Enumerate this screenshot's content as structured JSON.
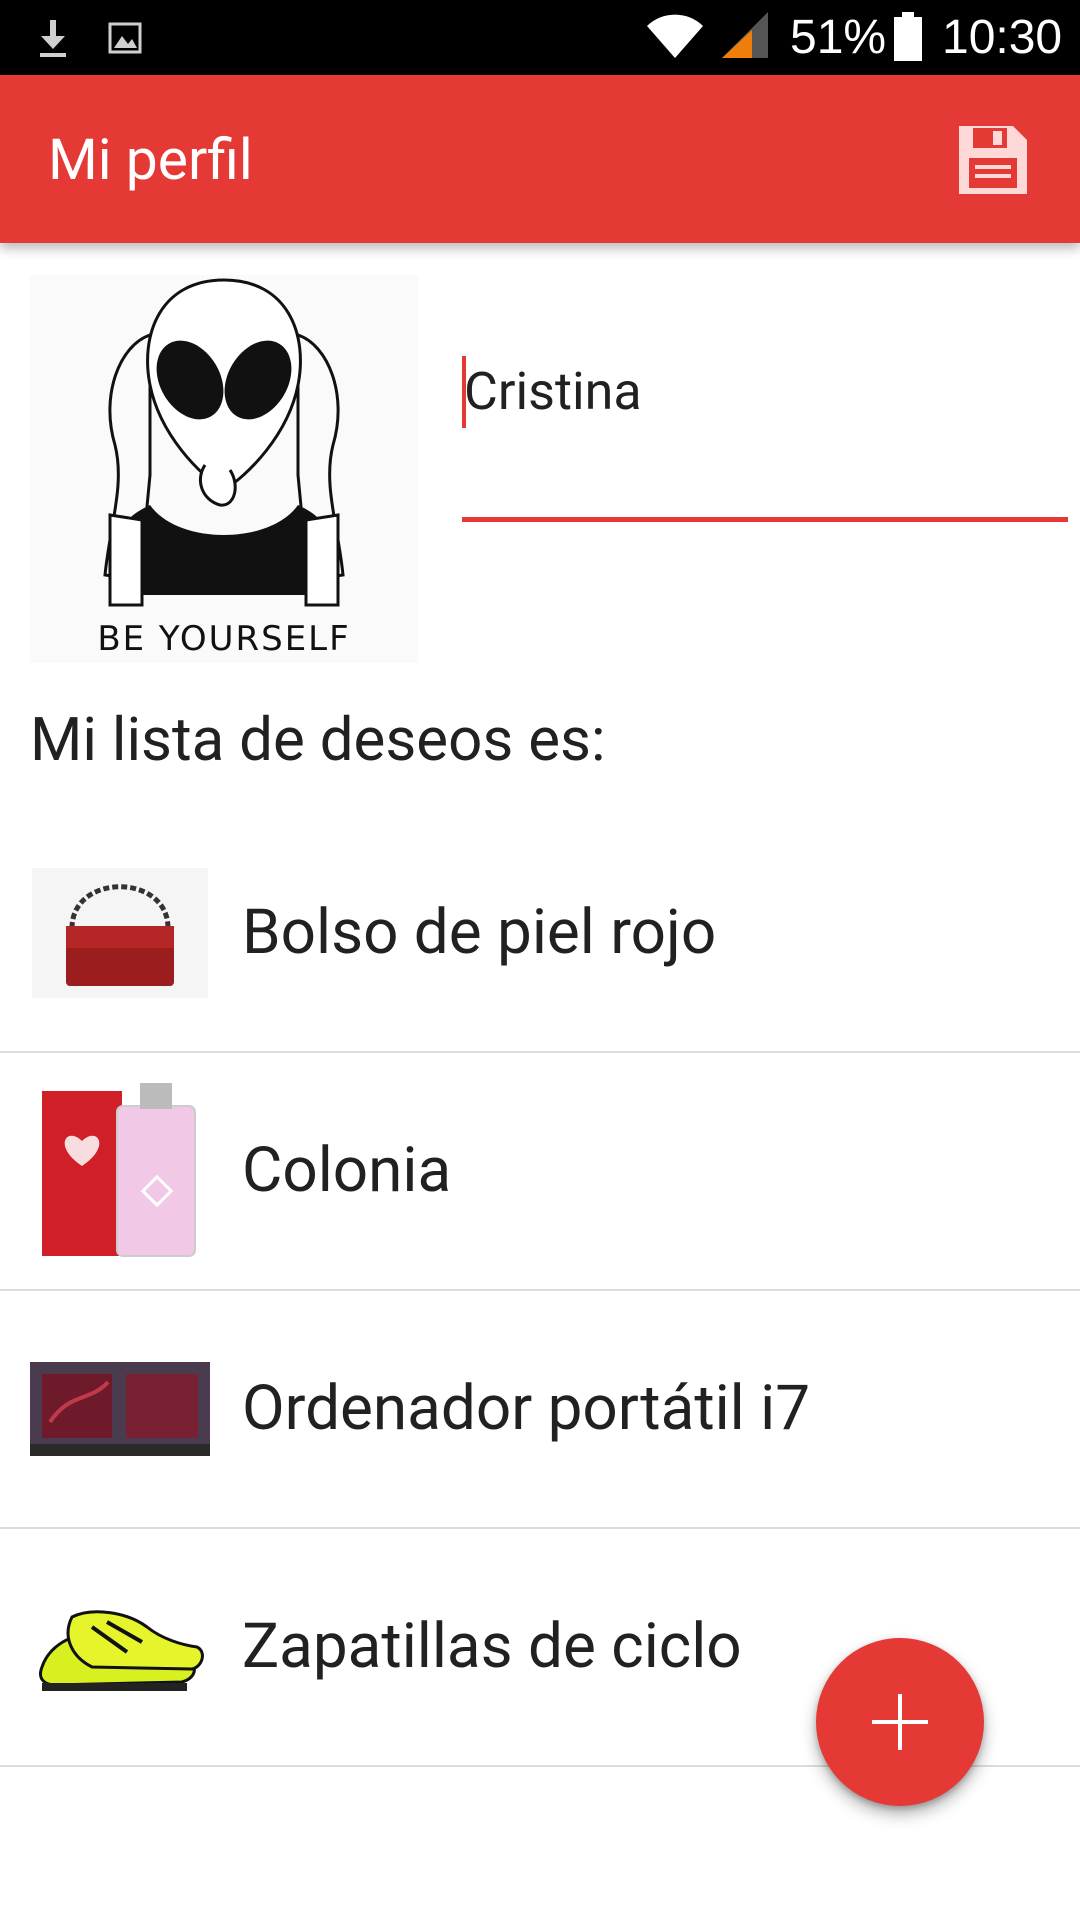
{
  "status_bar": {
    "battery_text": "51%",
    "time": "10:30",
    "icons": [
      "download-icon",
      "image-icon",
      "wifi-icon",
      "signal-icon",
      "battery-icon"
    ]
  },
  "toolbar": {
    "title": "Mi perfil",
    "save_icon": "floppy-disk-icon"
  },
  "profile": {
    "avatar_caption": "BE YOURSELF",
    "name_value": "Cristina"
  },
  "wishlist": {
    "heading": "Mi lista de deseos es:",
    "items": [
      {
        "label": "Bolso de piel rojo",
        "icon": "handbag-thumbnail"
      },
      {
        "label": "Colonia",
        "icon": "perfume-thumbnail"
      },
      {
        "label": "Ordenador portátil i7",
        "icon": "laptop-box-thumbnail"
      },
      {
        "label": "Zapatillas de ciclo",
        "icon": "cycling-shoes-thumbnail"
      }
    ]
  },
  "fab": {
    "icon": "plus-icon"
  },
  "colors": {
    "accent": "#e53935",
    "status_bar": "#000000",
    "text": "#212121",
    "divider": "#dcdcdc"
  }
}
